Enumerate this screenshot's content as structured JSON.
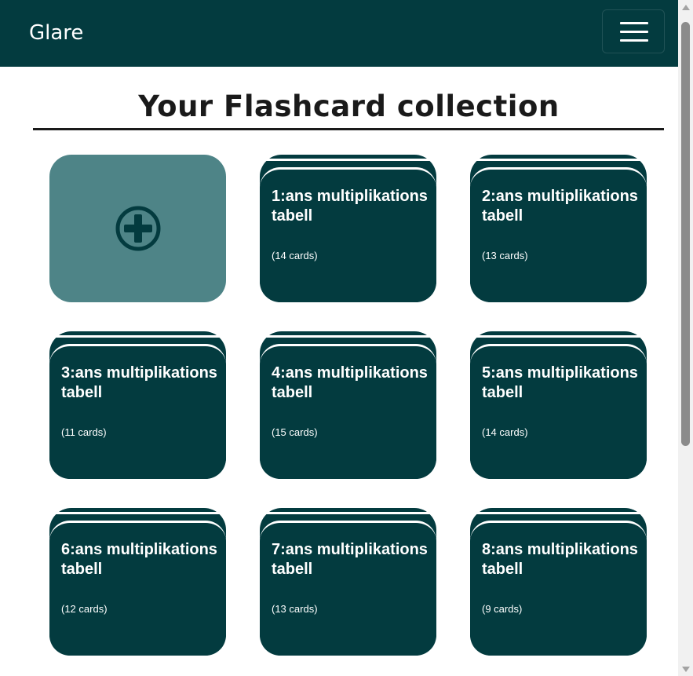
{
  "navbar": {
    "brand": "Glare",
    "menu_icon": "hamburger-menu-icon",
    "background_color": "#033b3f"
  },
  "main": {
    "title": "Your Flashcard collection",
    "add_card": {
      "icon": "plus-circle-icon",
      "background_color": "#4e8487"
    },
    "decks": [
      {
        "name": "1:ans multiplikationstabell",
        "count": "(14 cards)"
      },
      {
        "name": "2:ans multiplikationstabell",
        "count": "(13 cards)"
      },
      {
        "name": "3:ans multiplikationstabell",
        "count": "(11 cards)"
      },
      {
        "name": "4:ans multiplikationstabell",
        "count": "(15 cards)"
      },
      {
        "name": "5:ans multiplikationstabell",
        "count": "(14 cards)"
      },
      {
        "name": "6:ans multiplikationstabell",
        "count": "(12 cards)"
      },
      {
        "name": "7:ans multiplikationstabell",
        "count": "(13 cards)"
      },
      {
        "name": "8:ans multiplikationstabell",
        "count": "(9 cards)"
      }
    ],
    "deck_color": "#033b3f"
  }
}
